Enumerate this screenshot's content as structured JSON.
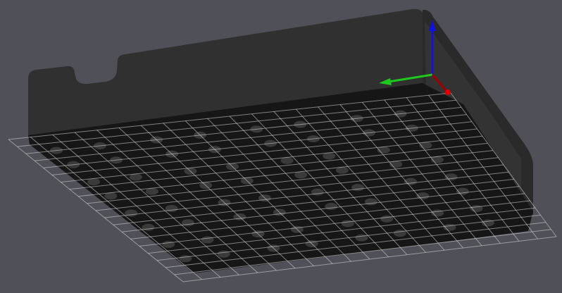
{
  "viewport": {
    "background_color": "#505058",
    "model_color": "#2f2f2f",
    "model_bottom_color": "#141414",
    "grid_color": "#d8d8d8",
    "grid_divisions": 20
  },
  "axes": {
    "x_color": "#e00000",
    "y_color": "#1ec81e",
    "z_color": "#1010e0"
  }
}
